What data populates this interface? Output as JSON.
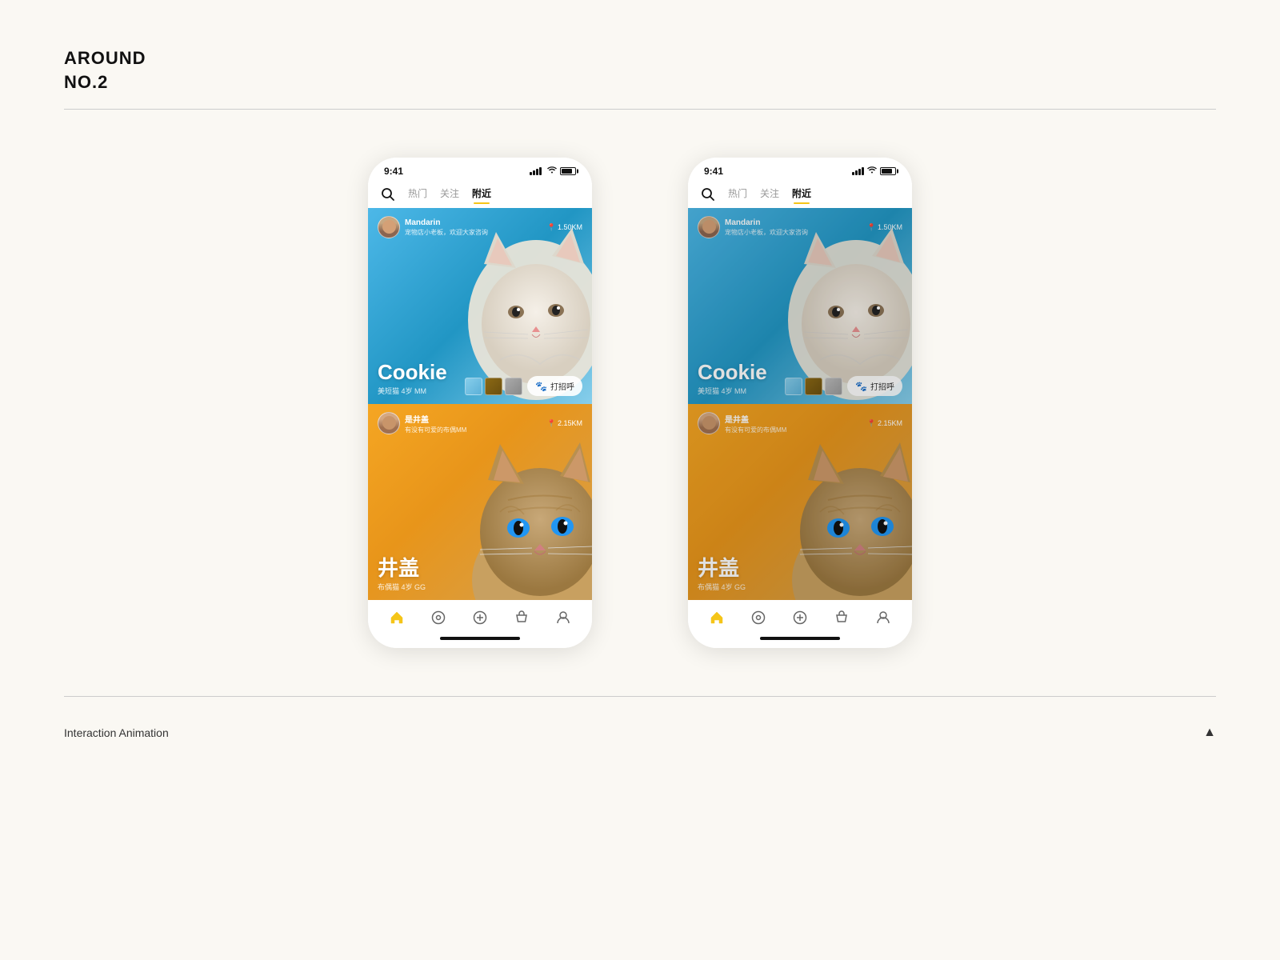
{
  "header": {
    "title_line1": "AROUND",
    "title_line2": "NO.2"
  },
  "phones": [
    {
      "id": "phone-left",
      "status_bar": {
        "time": "9:41"
      },
      "nav": {
        "tabs": [
          "热门",
          "关注",
          "附近"
        ],
        "active_tab": "附近"
      },
      "cards": [
        {
          "id": "card-cookie",
          "color": "blue",
          "user": {
            "name": "Mandarin",
            "subtitle": "宠物店小老板，欢迎大家咨询"
          },
          "distance": "1.50KM",
          "pet_name": "Cookie",
          "pet_details": "美短猫  4岁  MM",
          "greet_btn": "打招呼"
        },
        {
          "id": "card-jinggai",
          "color": "orange",
          "user": {
            "name": "是井盖",
            "subtitle": "有没有可爱的布偶MM"
          },
          "distance": "2.15KM",
          "pet_name": "井盖",
          "pet_details": "布偶猫  4岁  GG"
        }
      ],
      "bottom_nav": [
        "🏠",
        "◎",
        "⊕",
        "🛍",
        "👤"
      ]
    },
    {
      "id": "phone-right",
      "status_bar": {
        "time": "9:41"
      },
      "nav": {
        "tabs": [
          "热门",
          "关注",
          "附近"
        ],
        "active_tab": "附近"
      },
      "cards": [
        {
          "id": "card-cookie-2",
          "color": "blue",
          "user": {
            "name": "Mandarin",
            "subtitle": "宠物店小老板，欢迎大家咨询"
          },
          "distance": "1.50KM",
          "pet_name": "Cookie",
          "pet_details": "美短猫  4岁  MM",
          "greet_btn": "打招呼"
        },
        {
          "id": "card-jinggai-2",
          "color": "orange",
          "user": {
            "name": "是井盖",
            "subtitle": "有没有可爱的布偶MM"
          },
          "distance": "2.15KM",
          "pet_name": "井盖",
          "pet_details": "布偶猫  4岁  GG"
        }
      ],
      "bottom_nav": [
        "🏠",
        "◎",
        "⊕",
        "🛍",
        "👤"
      ]
    }
  ],
  "footer": {
    "label": "Interaction Animation",
    "icon": "▲"
  }
}
